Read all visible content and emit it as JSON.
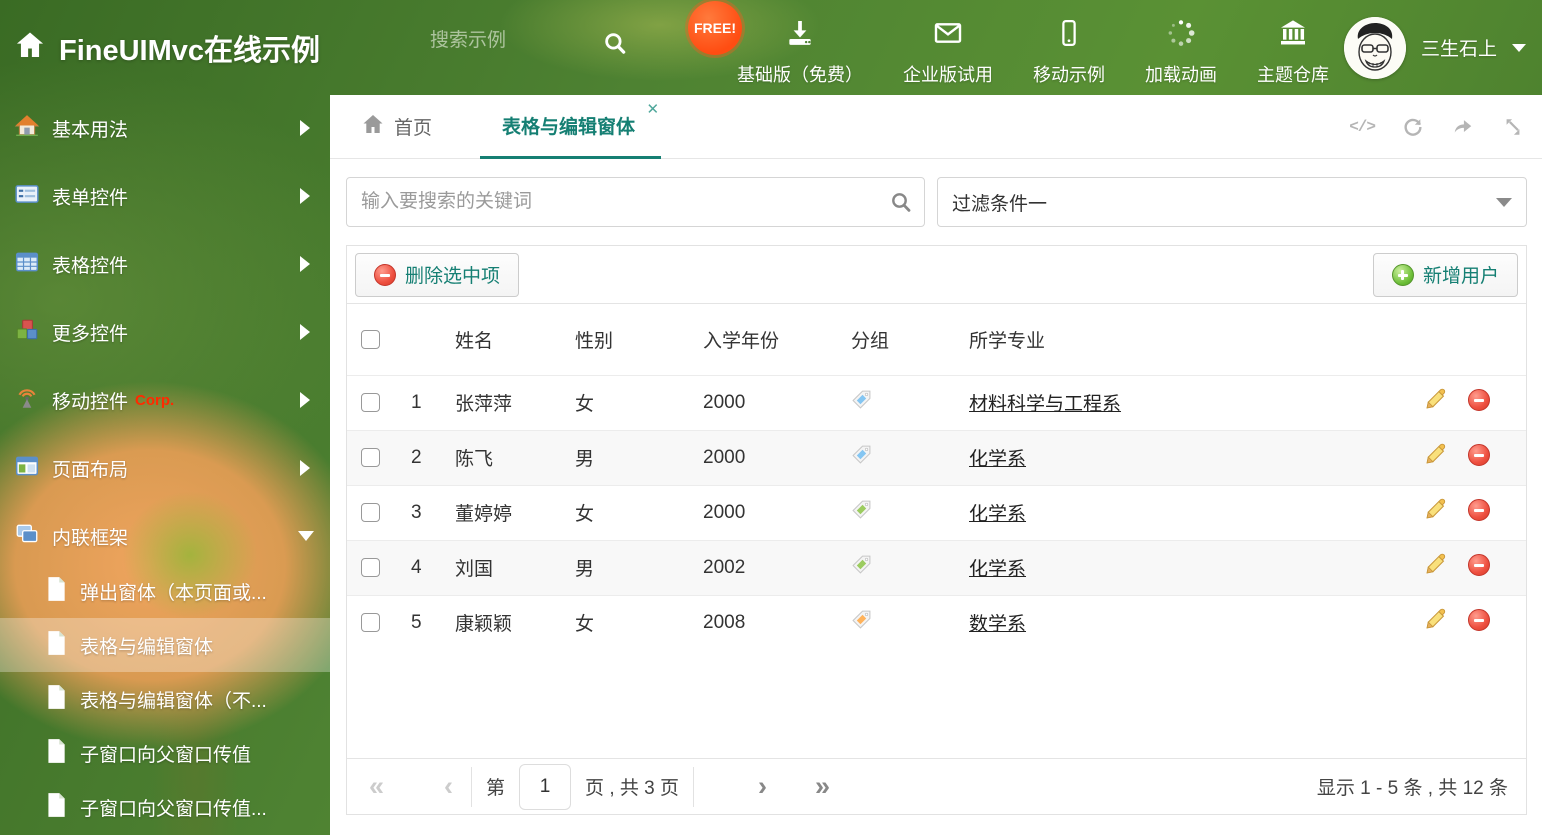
{
  "colors": {
    "accent": "#157f73",
    "header_green": "#4e8232",
    "badge_orange": "#ff4d12",
    "link": "#222222"
  },
  "header": {
    "title": "FineUIMvc在线示例",
    "search_placeholder": "搜索示例",
    "free_badge": "FREE!",
    "nav": [
      {
        "label": "基础版（免费）",
        "icon": "download-icon"
      },
      {
        "label": "企业版试用",
        "icon": "mail-icon"
      },
      {
        "label": "移动示例",
        "icon": "mobile-icon"
      },
      {
        "label": "加载动画",
        "icon": "spinner-icon"
      },
      {
        "label": "主题仓库",
        "icon": "bank-icon"
      }
    ],
    "user": {
      "name": "三生石上"
    }
  },
  "sidebar": {
    "items": [
      {
        "label": "基本用法",
        "icon": "home-icon"
      },
      {
        "label": "表单控件",
        "icon": "form-icon"
      },
      {
        "label": "表格控件",
        "icon": "table-icon"
      },
      {
        "label": "更多控件",
        "icon": "cubes-icon"
      },
      {
        "label": "移动控件",
        "badge": "Corp.",
        "icon": "antenna-icon"
      },
      {
        "label": "页面布局",
        "icon": "layout-icon"
      },
      {
        "label": "内联框架",
        "icon": "frames-icon",
        "expanded": true
      }
    ],
    "subitems": [
      {
        "label": "弹出窗体（本页面或..."
      },
      {
        "label": "表格与编辑窗体",
        "selected": true
      },
      {
        "label": "表格与编辑窗体（不..."
      },
      {
        "label": "子窗口向父窗口传值"
      },
      {
        "label": "子窗口向父窗口传值..."
      }
    ]
  },
  "tabs": {
    "home": {
      "label": "首页"
    },
    "active": {
      "label": "表格与编辑窗体",
      "close": "✕"
    }
  },
  "filters": {
    "search_placeholder": "输入要搜索的关键词",
    "filter_value": "过滤条件一"
  },
  "toolbar": {
    "delete_label": "删除选中项",
    "add_label": "新增用户"
  },
  "table": {
    "columns": {
      "name": "姓名",
      "gender": "性别",
      "year": "入学年份",
      "group": "分组",
      "major": "所学专业"
    },
    "rows": [
      {
        "index": "1",
        "name": "张萍萍",
        "gender": "女",
        "year": "2000",
        "tag_color": "blue",
        "major": "材料科学与工程系"
      },
      {
        "index": "2",
        "name": "陈飞",
        "gender": "男",
        "year": "2000",
        "tag_color": "blue",
        "major": "化学系"
      },
      {
        "index": "3",
        "name": "董婷婷",
        "gender": "女",
        "year": "2000",
        "tag_color": "green",
        "major": "化学系"
      },
      {
        "index": "4",
        "name": "刘国",
        "gender": "男",
        "year": "2002",
        "tag_color": "green",
        "major": "化学系"
      },
      {
        "index": "5",
        "name": "康颖颖",
        "gender": "女",
        "year": "2008",
        "tag_color": "orange",
        "major": "数学系"
      }
    ]
  },
  "pagination": {
    "first": "«",
    "prev": "‹",
    "next": "›",
    "last": "»",
    "page_prefix": "第",
    "page_value": "1",
    "page_suffix": "页 , 共 3 页",
    "summary": "显示 1 - 5 条 , 共 12 条"
  }
}
